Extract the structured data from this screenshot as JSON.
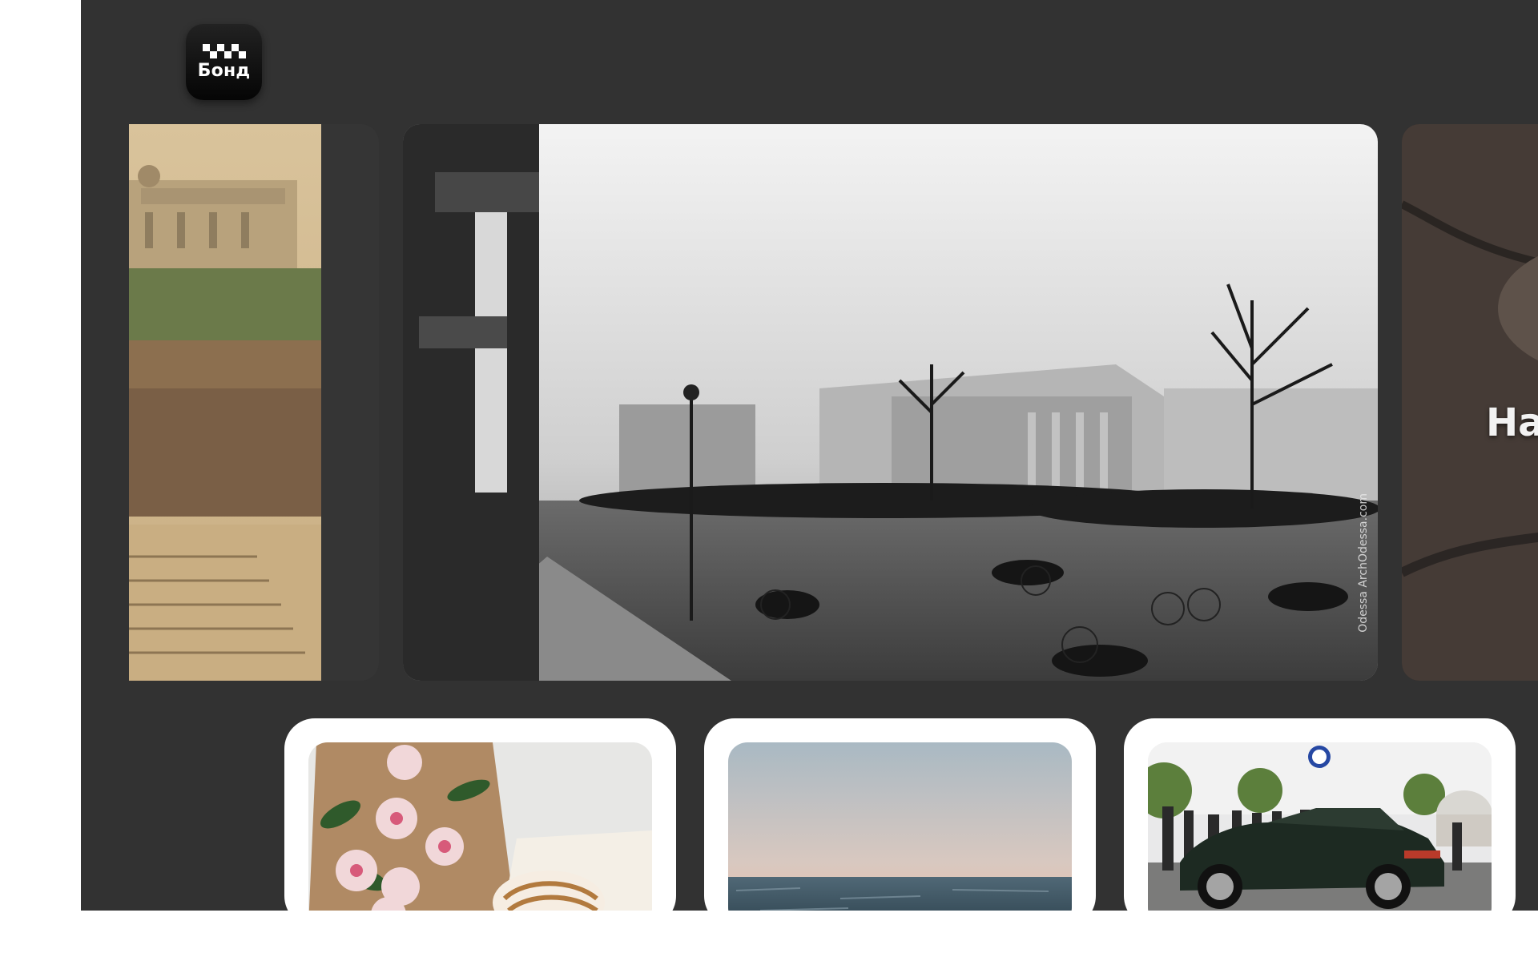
{
  "brand": {
    "name": "Бонд",
    "logo_icon": "taxi-checker-icon"
  },
  "slider": {
    "slides": [
      {
        "name": "odessa-potemkin-stairs-photo",
        "caption": ""
      },
      {
        "name": "odessa-historic-street-photo",
        "watermark": "Odessa ArchOdessa.com"
      },
      {
        "name": "eye-closeup-photo",
        "caption": "Наши"
      }
    ]
  },
  "cards": [
    {
      "name": "flowers-and-donut-photo"
    },
    {
      "name": "sea-sunset-photo"
    },
    {
      "name": "black-sports-car-photo"
    }
  ],
  "colors": {
    "app_background": "#323232",
    "page_background": "#ffffff",
    "card_background": "#ffffff",
    "logo_background": "#111111"
  }
}
